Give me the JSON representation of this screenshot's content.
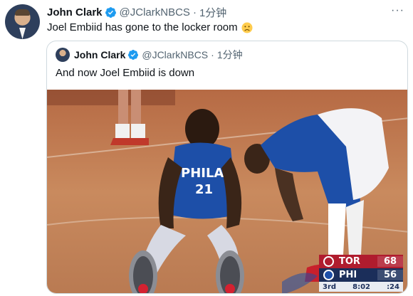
{
  "tweet": {
    "author_name": "John Clark",
    "handle": "@JClarkNBCS",
    "separator": "·",
    "time": "1分钟",
    "text": "Joel Embiid has gone to the locker room",
    "emoji_icon": "sad-face-icon",
    "more_label": "···"
  },
  "quoted": {
    "author_name": "John Clark",
    "handle": "@JClarkNBCS",
    "separator": "·",
    "time": "1分钟",
    "text": "And now Joel Embiid is down",
    "jersey": {
      "team": "PHILA",
      "number": "21"
    }
  },
  "scoreboard": {
    "team1": "TOR",
    "score1": "68",
    "team2": "PHI",
    "score2": "56",
    "period": "3rd",
    "clock": "8:02",
    "shot_clock": ":24"
  },
  "colors": {
    "verified": "#1d9bf0",
    "text": "#0f1419",
    "secondary": "#536471",
    "border": "#cfd9de",
    "sixers_blue": "#1d4fa8",
    "raptors_red": "#b01c2e"
  }
}
